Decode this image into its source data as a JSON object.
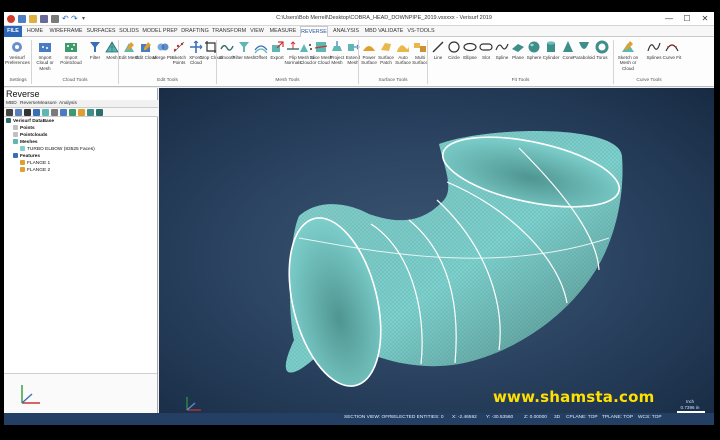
{
  "window": {
    "title": "C:\\Users\\Bob Merrell\\Desktop\\COBRA_HEAD_DOWNPIPE_2019.vsxxxx - Verisurf 2019",
    "minimize": "—",
    "maximize": "☐",
    "close": "✕"
  },
  "ribbon_tabs": [
    "FILE",
    "HOME",
    "WIREFRAME",
    "SURFACES",
    "SOLIDS",
    "MODEL PREP",
    "DRAFTING",
    "TRANSFORM",
    "VIEW",
    "MEASURE",
    "REVERSE",
    "ANALYSIS",
    "MBD VALIDATE",
    "VS-TOOLS"
  ],
  "active_tab": "REVERSE",
  "ribbon": {
    "buttons": [
      {
        "label": "Verisurf Preferences",
        "icon": "preferences-icon"
      },
      {
        "label": "Import Cloud or Mesh",
        "icon": "import-cloud-icon"
      },
      {
        "label": "Import Pointcloud",
        "icon": "import-pointcloud-icon"
      },
      {
        "label": "Filter",
        "icon": "filter-icon"
      },
      {
        "label": "Mesh",
        "icon": "mesh-icon"
      },
      {
        "label": "Edit Mesh",
        "icon": "edit-mesh-icon"
      },
      {
        "label": "Edit Cloud",
        "icon": "edit-cloud-icon"
      },
      {
        "label": "Merge Pts",
        "icon": "merge-icon"
      },
      {
        "label": "Sketch Points",
        "icon": "sketch-points-icon"
      },
      {
        "label": "XForm Cloud",
        "icon": "xform-icon"
      },
      {
        "label": "Crop Cloud",
        "icon": "crop-icon"
      },
      {
        "label": "Smooth",
        "icon": "smooth-icon"
      },
      {
        "label": "Filter Mesh",
        "icon": "filter-mesh-icon"
      },
      {
        "label": "Offset",
        "icon": "offset-icon"
      },
      {
        "label": "Export",
        "icon": "export-icon"
      },
      {
        "label": "Flip Normals",
        "icon": "flip-normals-icon"
      },
      {
        "label": "Mesh to Cloud",
        "icon": "mesh-to-cloud-icon"
      },
      {
        "label": "Slice Mesh or Cloud",
        "icon": "slice-icon"
      },
      {
        "label": "Project Mesh",
        "icon": "project-mesh-icon"
      },
      {
        "label": "Extend Mesh",
        "icon": "extend-mesh-icon"
      },
      {
        "label": "Power Surface",
        "icon": "power-surface-icon"
      },
      {
        "label": "Surface Patch",
        "icon": "surface-patch-icon"
      },
      {
        "label": "Auto Surface",
        "icon": "auto-surface-icon"
      },
      {
        "label": "Multi Surface",
        "icon": "multi-surface-icon"
      },
      {
        "label": "Line",
        "icon": "line-icon"
      },
      {
        "label": "Circle",
        "icon": "circle-icon"
      },
      {
        "label": "Ellipse",
        "icon": "ellipse-icon"
      },
      {
        "label": "Slot",
        "icon": "slot-icon"
      },
      {
        "label": "Spline",
        "icon": "spline-icon"
      },
      {
        "label": "Plane",
        "icon": "plane-icon"
      },
      {
        "label": "Sphere",
        "icon": "sphere-icon"
      },
      {
        "label": "Cylinder",
        "icon": "cylinder-icon"
      },
      {
        "label": "Cone",
        "icon": "cone-icon"
      },
      {
        "label": "Paraboloid",
        "icon": "paraboloid-icon"
      },
      {
        "label": "Torus",
        "icon": "torus-icon"
      },
      {
        "label": "Sketch on Mesh or Cloud",
        "icon": "sketch-on-mesh-icon"
      },
      {
        "label": "Splines",
        "icon": "splines-icon"
      },
      {
        "label": "Curve Fit",
        "icon": "curve-fit-icon"
      }
    ],
    "groups": [
      "Settings",
      "Cloud Tools",
      "Edit Tools",
      "Mesh Tools",
      "Surface Tools",
      "Fit Tools",
      "Curve Tools"
    ]
  },
  "panel": {
    "title": "Reverse",
    "tabs": [
      "MBD",
      "Reverse",
      "Measure",
      "Analysis"
    ],
    "tree": [
      {
        "label": "Verisurf DataBase",
        "bold": true
      },
      {
        "label": "Points",
        "bold": true
      },
      {
        "label": "Pointclouds",
        "bold": true
      },
      {
        "label": "Meshes",
        "bold": true
      },
      {
        "label": "TURBO ELBOW (83525 Faces)",
        "bold": false
      },
      {
        "label": "Features",
        "bold": true
      },
      {
        "label": "FLANGE 1",
        "bold": false
      },
      {
        "label": "FLANGE 2",
        "bold": false
      }
    ]
  },
  "viewport": {
    "watermark": "www.shamsta.com",
    "scale_value": "0.7396 in",
    "scale_unit": "Inch"
  },
  "status_bar": [
    "SECTION VIEW: OFF",
    "SELECTED ENTITIES: 0",
    "X: -2.46592",
    "Y: -30.53560",
    "Z: 0.00000",
    "3D",
    "CPLANE: TOP",
    "TPLANE: TOP",
    "WCS: TOP"
  ],
  "colors": {
    "file_tab": "#2b66b8",
    "mesh": "#7ed0cd",
    "viewport_bg": "#2c4563",
    "status_bg": "#233f63",
    "watermark": "#ffe000"
  }
}
